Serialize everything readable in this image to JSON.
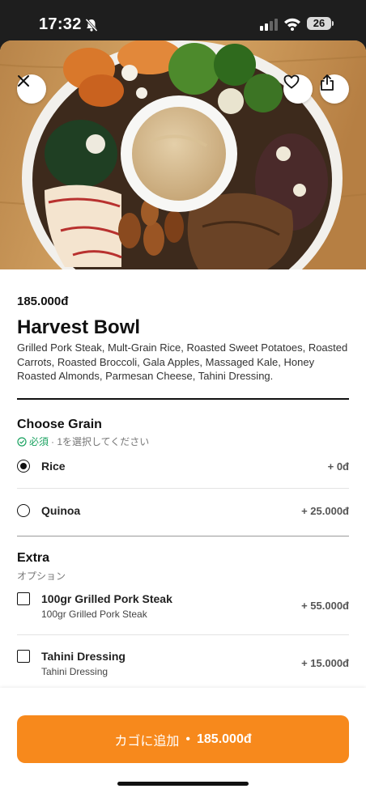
{
  "status_bar": {
    "time": "17:32",
    "battery": "26"
  },
  "product": {
    "price": "185.000đ",
    "name": "Harvest Bowl",
    "description": "Grilled Pork Steak, Mult-Grain Rice, Roasted Sweet Potatoes, Roasted Carrots, Roasted Broccoli, Gala Apples, Massaged Kale, Honey Roasted Almonds, Parmesan Cheese, Tahini Dressing."
  },
  "grain_section": {
    "title": "Choose Grain",
    "required_label": "必須",
    "required_hint": "· 1を選択してください",
    "options": [
      {
        "label": "Rice",
        "price": "+ 0đ",
        "selected": true
      },
      {
        "label": "Quinoa",
        "price": "+ 25.000đ",
        "selected": false
      }
    ]
  },
  "extra_section": {
    "title": "Extra",
    "subtitle": "オプション",
    "options": [
      {
        "label": "100gr Grilled Pork Steak",
        "sub": "100gr Grilled Pork Steak",
        "price": "+ 55.000đ"
      },
      {
        "label": "Tahini Dressing",
        "sub": "Tahini Dressing",
        "price": "+ 15.000đ"
      }
    ]
  },
  "footer": {
    "cart_label": "カゴに追加",
    "separator": "•",
    "total": "185.000đ"
  },
  "colors": {
    "accent": "#f7891c",
    "required_green": "#1aa260"
  },
  "icons": [
    "bell-slash-icon",
    "cellular-signal-icon",
    "wifi-icon",
    "battery-icon",
    "close-icon",
    "heart-icon",
    "share-icon",
    "check-circle-icon"
  ]
}
